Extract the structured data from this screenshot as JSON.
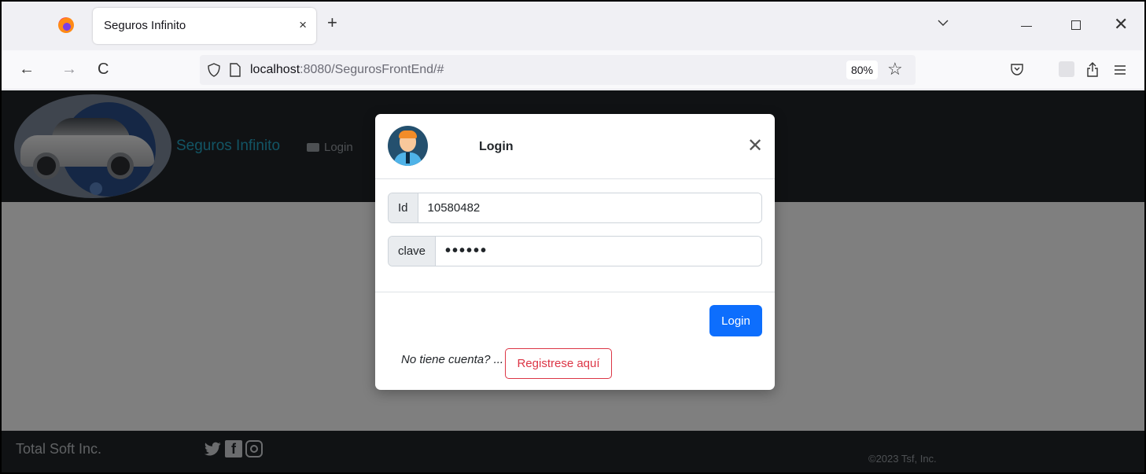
{
  "browser": {
    "tab_title": "Seguros Infinito",
    "tab_close": "×",
    "new_tab": "+",
    "url_host": "localhost",
    "url_rest": ":8080/SegurosFrontEnd/#",
    "zoom": "80%",
    "nav_back": "←",
    "nav_forward": "→",
    "nav_reload": "C",
    "bookmark_star": "☆",
    "window_close": "✕"
  },
  "header": {
    "brand": "Seguros Infinito",
    "nav_login": "Login"
  },
  "modal": {
    "title": "Login",
    "close": "✕",
    "id_label": "Id",
    "id_value": "10580482",
    "clave_label": "clave",
    "clave_value": "••••••",
    "login_button": "Login",
    "no_account_text": "No tiene cuenta? ...",
    "register_button": "Registrese aquí"
  },
  "footer": {
    "brand": "Total Soft Inc.",
    "copyright": "©2023 Tsf, Inc."
  },
  "colors": {
    "primary": "#0d6efd",
    "danger": "#dc3545",
    "brand": "#25a9c8",
    "header_bg": "#212529"
  }
}
